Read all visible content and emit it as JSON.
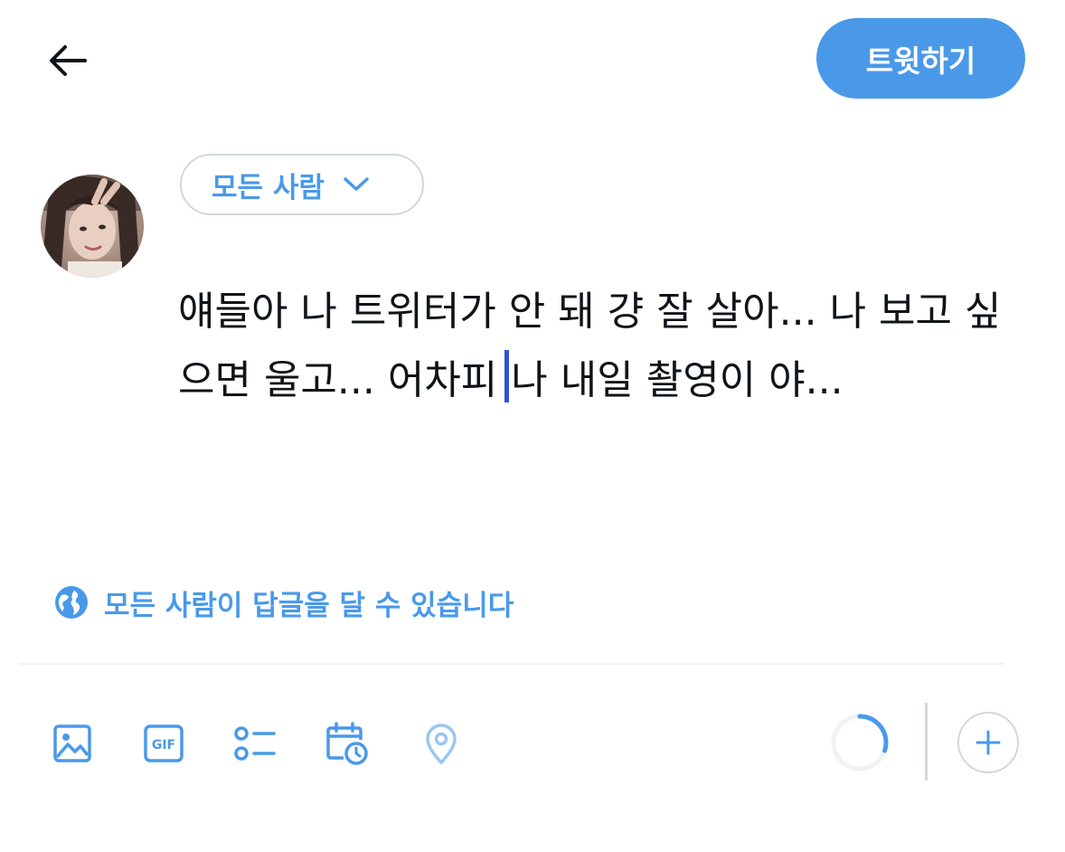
{
  "header": {
    "back_icon": "arrow-left-icon",
    "tweet_button_label": "트윗하기"
  },
  "audience": {
    "label": "모든 사람",
    "chevron_icon": "chevron-down-icon"
  },
  "composer": {
    "text_before_caret": "얘들아 나 트위터가 안 돼 걍 잘 살아... 나 보고 싶으면 울고... 어차피",
    "text_after_caret": "나 내일 촬영이 야..."
  },
  "reply_setting": {
    "icon": "globe-icon",
    "label": "모든 사람이 답글을 달 수 있습니다"
  },
  "toolbar": {
    "items": [
      "image-icon",
      "gif-icon",
      "poll-icon",
      "schedule-icon",
      "location-icon"
    ],
    "character_progress": 0.3,
    "add_icon": "plus-icon"
  },
  "colors": {
    "accent": "#4a99e9",
    "text": "#0f1419",
    "border": "#cfd9de",
    "caret": "#2f55d4"
  }
}
